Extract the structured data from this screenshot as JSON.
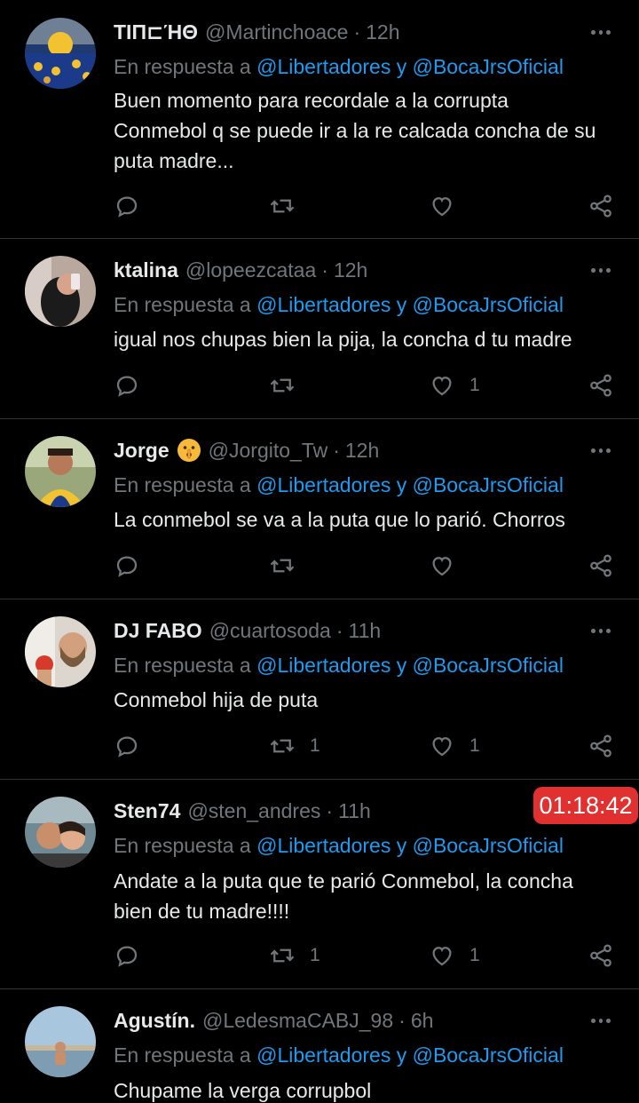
{
  "reply_prefix": "En respuesta a",
  "reply_link": "@Libertadores y @BocaJrsOficial",
  "timer": "01:18:42",
  "colors": {
    "background": "#000000",
    "link": "#1d9bf0",
    "muted": "#71767b",
    "timer_bg": "#e0302f"
  },
  "tweets": [
    {
      "name": "ΤΙΠ⊏ΉΘ",
      "handle": "@Martinchoace",
      "time": "12h",
      "text": "Buen momento para recordale a la corrupta Conmebol q se puede ir a la re calcada concha de su puta madre...",
      "retweets": "",
      "likes": ""
    },
    {
      "name": "ktalina",
      "handle": "@lopeezcataa",
      "time": "12h",
      "text": "igual nos chupas bien la pija, la concha d tu madre",
      "retweets": "",
      "likes": "1"
    },
    {
      "name": "Jorge",
      "handle": "@Jorgito_Tw",
      "time": "12h",
      "emoji": "shushing-face-icon",
      "text": "La conmebol se va a la puta que lo parió. Chorros",
      "retweets": "",
      "likes": ""
    },
    {
      "name": "DJ FABO",
      "handle": "@cuartosoda",
      "time": "11h",
      "text": "Conmebol hija de puta",
      "retweets": "1",
      "likes": "1"
    },
    {
      "name": "Sten74",
      "handle": "@sten_andres",
      "time": "11h",
      "text": "Andate a la puta que te parió Conmebol, la concha bien de tu madre!!!!",
      "retweets": "1",
      "likes": "1"
    },
    {
      "name": "Agustín.",
      "handle": "@LedesmaCABJ_98",
      "time": "6h",
      "text": "Chupame la verga corrupbol",
      "retweets": "",
      "likes": ""
    }
  ]
}
